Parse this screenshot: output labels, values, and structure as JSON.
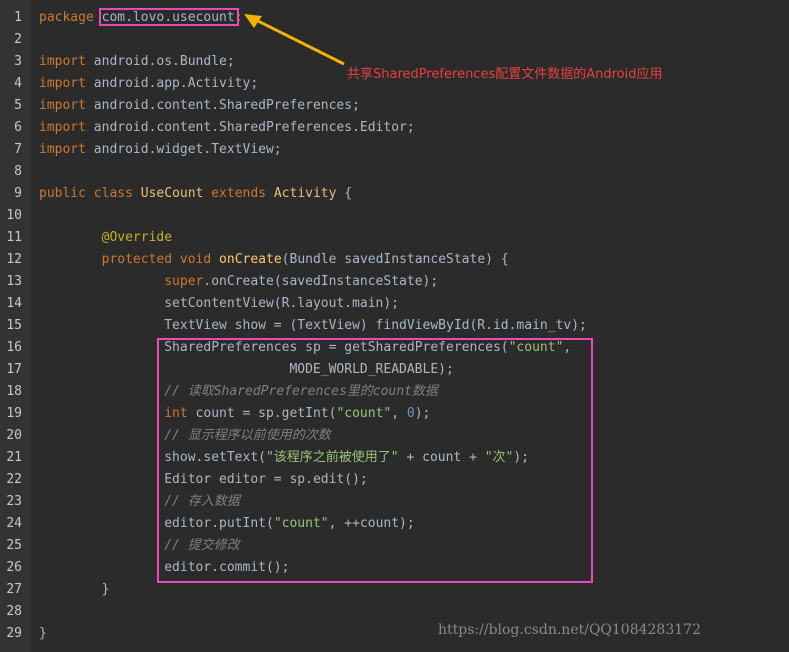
{
  "annotation": "共享SharedPreferences配置文件数据的Android应用",
  "watermark": "https://blog.csdn.net/QQ1084283172",
  "colors": {
    "background": "#2b2b2b",
    "keyword": "#cc7832",
    "string": "#98c379",
    "comment": "#808080",
    "highlight_box": "#e84ab8",
    "annotation_text": "#e84040",
    "arrow": "#f0b400"
  },
  "code": {
    "lines": [
      {
        "n": "1",
        "indent": "",
        "tokens": [
          {
            "t": "package",
            "c": "kw"
          },
          {
            "t": " "
          },
          {
            "t": "com.lovo.usecount"
          },
          {
            "t": ";"
          }
        ]
      },
      {
        "n": "2",
        "indent": "",
        "tokens": []
      },
      {
        "n": "3",
        "indent": "",
        "tokens": [
          {
            "t": "import",
            "c": "kw"
          },
          {
            "t": " android.os.Bundle;"
          }
        ]
      },
      {
        "n": "4",
        "indent": "",
        "tokens": [
          {
            "t": "import",
            "c": "kw"
          },
          {
            "t": " android.app.Activity;"
          }
        ]
      },
      {
        "n": "5",
        "indent": "",
        "tokens": [
          {
            "t": "import",
            "c": "kw"
          },
          {
            "t": " android.content.SharedPreferences;"
          }
        ]
      },
      {
        "n": "6",
        "indent": "",
        "tokens": [
          {
            "t": "import",
            "c": "kw"
          },
          {
            "t": " android.content.SharedPreferences.Editor;"
          }
        ]
      },
      {
        "n": "7",
        "indent": "",
        "tokens": [
          {
            "t": "import",
            "c": "kw"
          },
          {
            "t": " android.widget.TextView;"
          }
        ]
      },
      {
        "n": "8",
        "indent": "",
        "tokens": []
      },
      {
        "n": "9",
        "indent": "",
        "tokens": [
          {
            "t": "public",
            "c": "kw"
          },
          {
            "t": " "
          },
          {
            "t": "class",
            "c": "kw"
          },
          {
            "t": " "
          },
          {
            "t": "UseCount",
            "c": "cls"
          },
          {
            "t": " "
          },
          {
            "t": "extends",
            "c": "kw"
          },
          {
            "t": " "
          },
          {
            "t": "Activity",
            "c": "cls"
          },
          {
            "t": " {"
          }
        ]
      },
      {
        "n": "10",
        "indent": "",
        "tokens": []
      },
      {
        "n": "11",
        "indent": "        ",
        "tokens": [
          {
            "t": "@Override",
            "c": "ann"
          }
        ]
      },
      {
        "n": "12",
        "indent": "        ",
        "tokens": [
          {
            "t": "protected",
            "c": "kw"
          },
          {
            "t": " "
          },
          {
            "t": "void",
            "c": "kw"
          },
          {
            "t": " "
          },
          {
            "t": "onCreate",
            "c": "fn"
          },
          {
            "t": "(Bundle savedInstanceState) {"
          }
        ]
      },
      {
        "n": "13",
        "indent": "                ",
        "tokens": [
          {
            "t": "super",
            "c": "kw"
          },
          {
            "t": ".onCreate(savedInstanceState);"
          }
        ]
      },
      {
        "n": "14",
        "indent": "                ",
        "tokens": [
          {
            "t": "setContentView(R.layout.main);"
          }
        ]
      },
      {
        "n": "15",
        "indent": "                ",
        "tokens": [
          {
            "t": "TextView show = (TextView) findViewById(R.id.main_tv);"
          }
        ]
      },
      {
        "n": "16",
        "indent": "                ",
        "tokens": [
          {
            "t": "SharedPreferences sp = getSharedPreferences("
          },
          {
            "t": "\"count\"",
            "c": "strg"
          },
          {
            "t": ","
          }
        ]
      },
      {
        "n": "17",
        "indent": "                                ",
        "tokens": [
          {
            "t": "MODE_WORLD_READABLE);"
          }
        ]
      },
      {
        "n": "18",
        "indent": "                ",
        "tokens": [
          {
            "t": "// 读取SharedPreferences里的count数据",
            "c": "cmt"
          }
        ]
      },
      {
        "n": "19",
        "indent": "                ",
        "tokens": [
          {
            "t": "int",
            "c": "kw"
          },
          {
            "t": " count = sp.getInt("
          },
          {
            "t": "\"count\"",
            "c": "strg"
          },
          {
            "t": ", "
          },
          {
            "t": "0",
            "c": "num"
          },
          {
            "t": ");"
          }
        ]
      },
      {
        "n": "20",
        "indent": "                ",
        "tokens": [
          {
            "t": "// 显示程序以前使用的次数",
            "c": "cmt"
          }
        ]
      },
      {
        "n": "21",
        "indent": "                ",
        "tokens": [
          {
            "t": "show.setText("
          },
          {
            "t": "\"该程序之前被使用了\"",
            "c": "strg"
          },
          {
            "t": " + count + "
          },
          {
            "t": "\"次\"",
            "c": "strg"
          },
          {
            "t": ");"
          }
        ]
      },
      {
        "n": "22",
        "indent": "                ",
        "tokens": [
          {
            "t": "Editor editor = sp.edit();"
          }
        ]
      },
      {
        "n": "23",
        "indent": "                ",
        "tokens": [
          {
            "t": "// 存入数据",
            "c": "cmt"
          }
        ]
      },
      {
        "n": "24",
        "indent": "                ",
        "tokens": [
          {
            "t": "editor.putInt("
          },
          {
            "t": "\"count\"",
            "c": "strg"
          },
          {
            "t": ", ++count);"
          }
        ]
      },
      {
        "n": "25",
        "indent": "                ",
        "tokens": [
          {
            "t": "// 提交修改",
            "c": "cmt"
          }
        ]
      },
      {
        "n": "26",
        "indent": "                ",
        "tokens": [
          {
            "t": "editor.commit();"
          }
        ]
      },
      {
        "n": "27",
        "indent": "        ",
        "tokens": [
          {
            "t": "}"
          }
        ]
      },
      {
        "n": "28",
        "indent": "",
        "tokens": []
      },
      {
        "n": "29",
        "indent": "",
        "tokens": [
          {
            "t": "}"
          }
        ]
      }
    ]
  }
}
